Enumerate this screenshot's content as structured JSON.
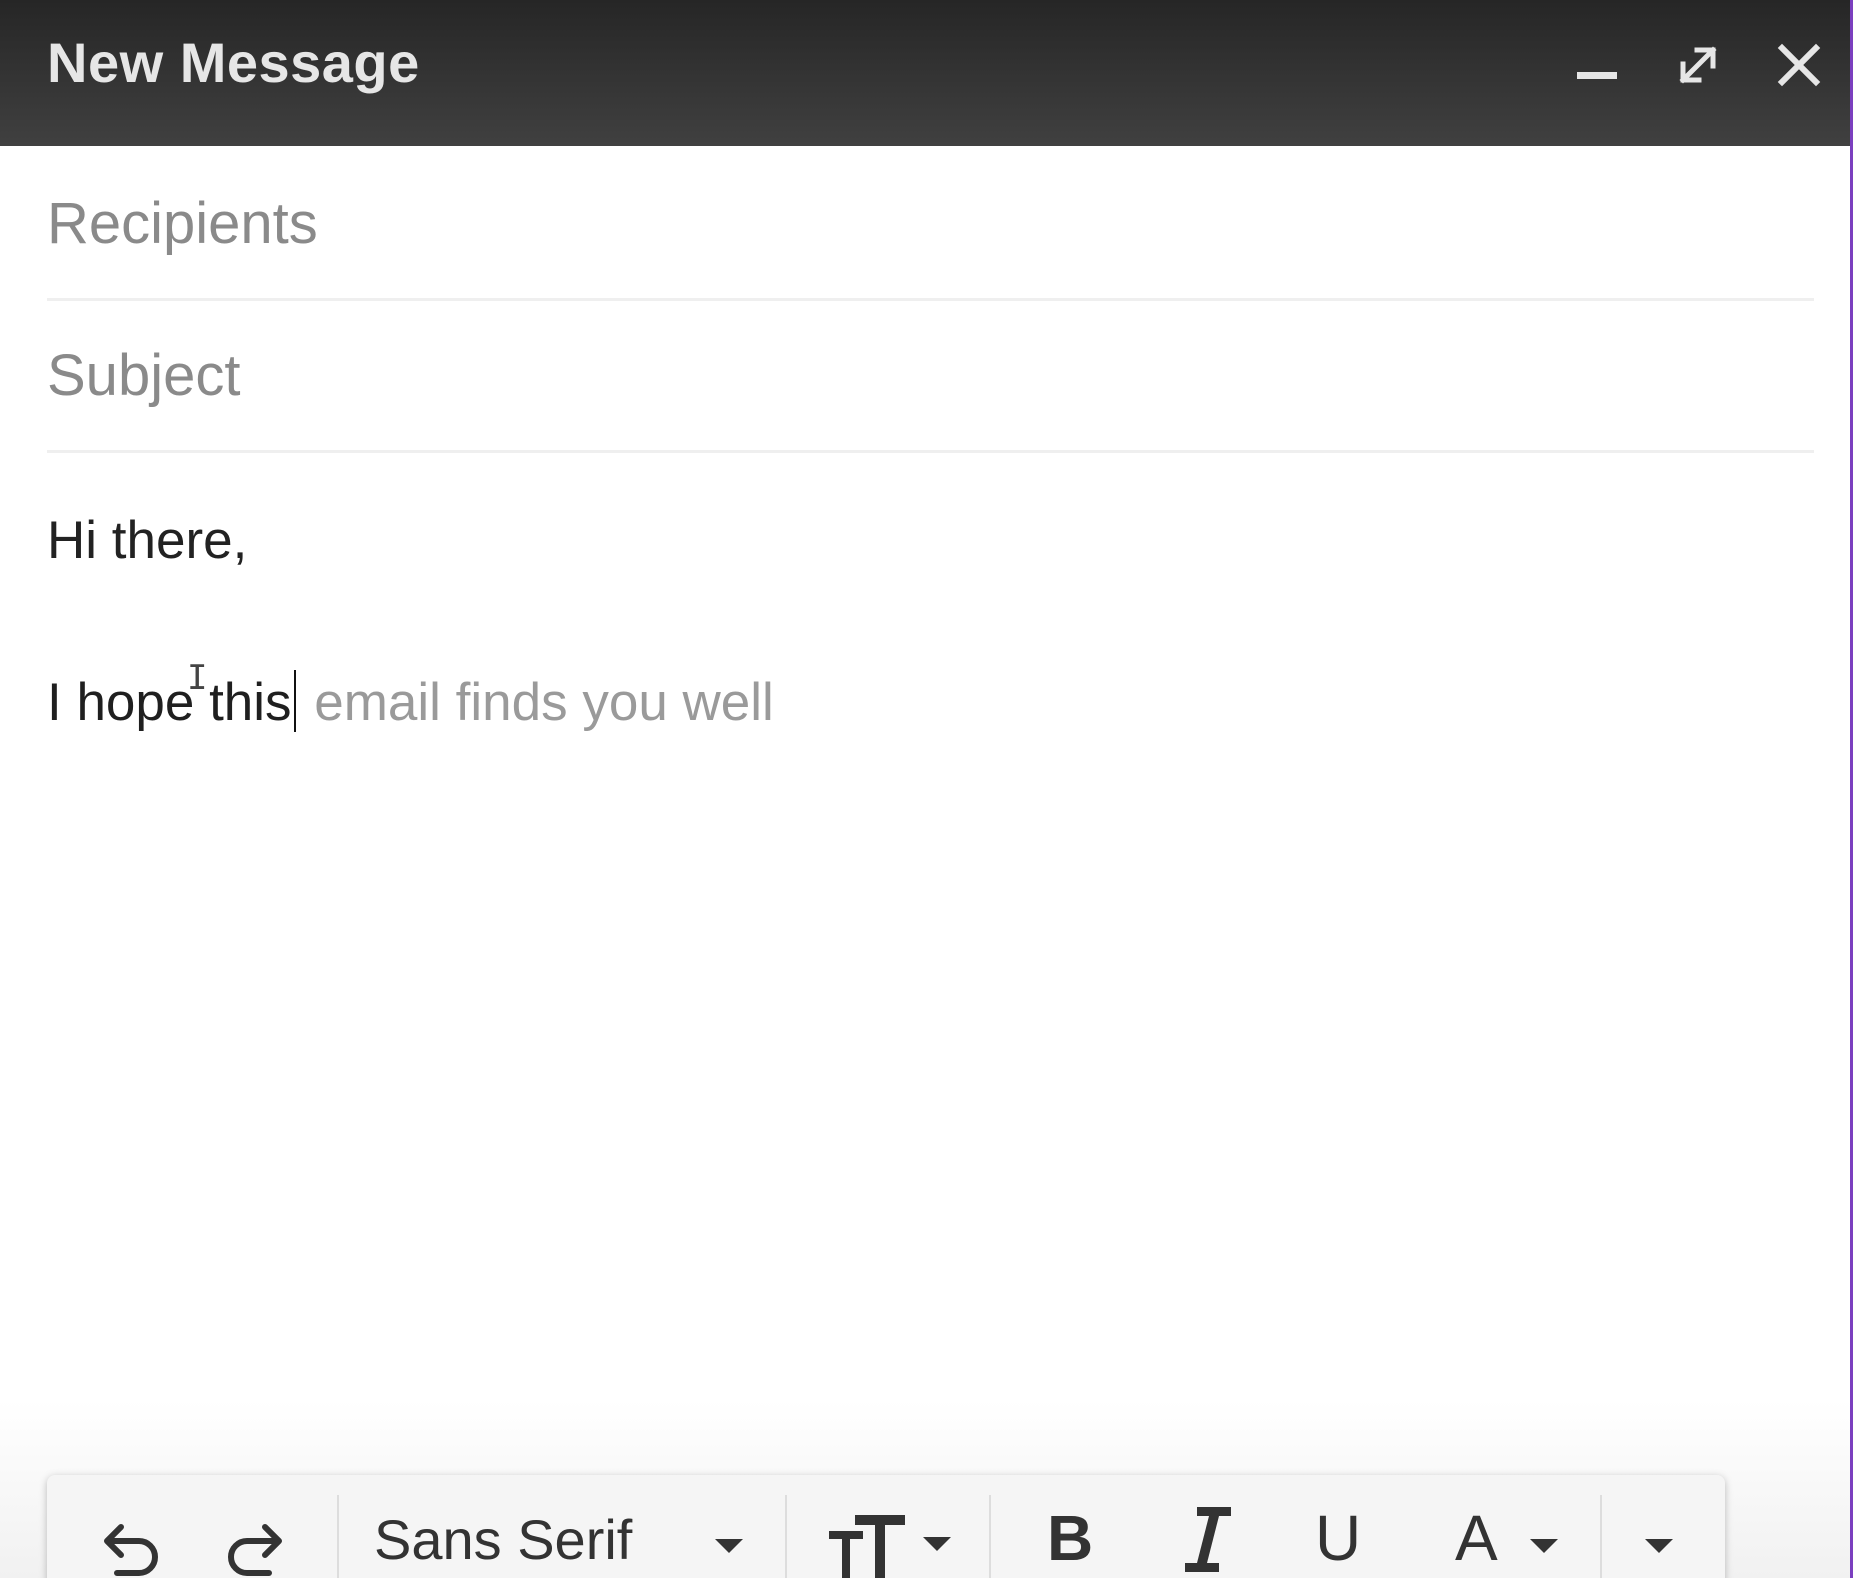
{
  "window": {
    "title": "New Message",
    "accent_color": "#7b3fbf",
    "titlebar_color": "#333333"
  },
  "titlebar_buttons": {
    "minimize_icon": "minimize-icon",
    "expand_icon": "expand-icon",
    "close_icon": "close-icon"
  },
  "fields": {
    "recipients_placeholder": "Recipients",
    "subject_placeholder": "Subject"
  },
  "body": {
    "line1": "Hi there,",
    "line2_typed": "I hope this",
    "line2_suggestion": " email finds you well"
  },
  "toolbar": {
    "undo_icon": "undo-icon",
    "redo_icon": "redo-icon",
    "font_family": "Sans Serif",
    "font_size_icon": "text-size-icon",
    "bold_label": "B",
    "italic_label": "I",
    "underline_label": "U",
    "text_color_label": "A",
    "more_options_icon": "chevron-down-icon"
  }
}
